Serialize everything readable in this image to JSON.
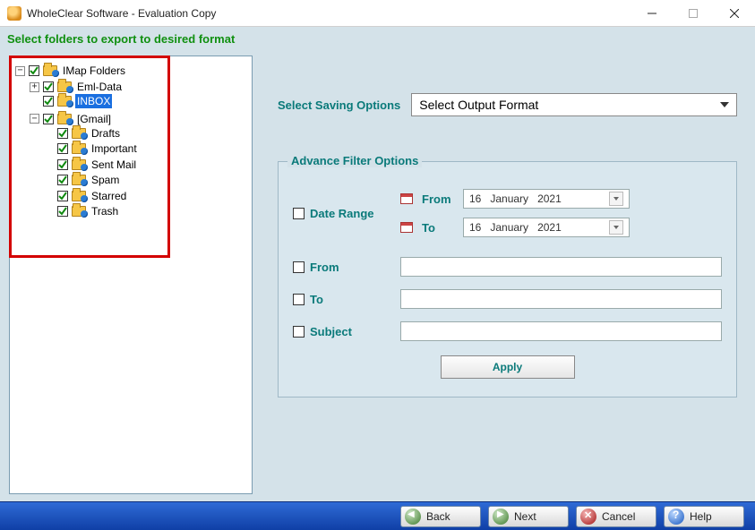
{
  "title": "WholeClear Software - Evaluation Copy",
  "banner": "Select folders to export to desired format",
  "tree": {
    "root": "IMap Folders",
    "root_toggle": "−",
    "items": [
      {
        "label": "Eml-Data",
        "toggle": "+"
      },
      {
        "label": "INBOX",
        "selected": true
      },
      {
        "label": "[Gmail]",
        "toggle": "−",
        "children": [
          "Drafts",
          "Important",
          "Sent Mail",
          "Spam",
          "Starred",
          "Trash"
        ]
      }
    ]
  },
  "saving": {
    "label": "Select Saving Options",
    "value": "Select Output Format"
  },
  "filter": {
    "title": "Advance Filter Options",
    "date_range": "Date Range",
    "from_lbl": "From",
    "to_lbl": "To",
    "date_from": {
      "d": "16",
      "m": "January",
      "y": "2021"
    },
    "date_to": {
      "d": "16",
      "m": "January",
      "y": "2021"
    },
    "from_field": "From",
    "to_field": "To",
    "subject_field": "Subject",
    "apply": "Apply"
  },
  "buttons": {
    "back": "Back",
    "next": "Next",
    "cancel": "Cancel",
    "help": "Help"
  }
}
